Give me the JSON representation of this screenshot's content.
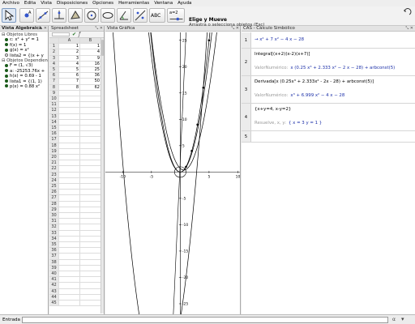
{
  "menu": [
    "Archivo",
    "Edita",
    "Vista",
    "Disposiciones",
    "Opciones",
    "Herramientas",
    "Ventana",
    "Ayuda"
  ],
  "toolbar": {
    "tools": [
      "move-tool",
      "point-tool",
      "line-tool",
      "perpendicular-tool",
      "polygon-tool",
      "circle-tool",
      "conic-tool",
      "angle-tool",
      "reflect-tool",
      "text-tool",
      "slider-tool",
      "move-view-tool"
    ],
    "text_tool_label": "ABC",
    "slider_tool_label": "a=2",
    "active_title": "Elige y Mueve",
    "active_desc": "Arrastra o selecciona objetos (Esc)"
  },
  "algebra": {
    "title": "Vista Algebraica",
    "controls": "⤡ ✕",
    "free_header": "⊟ Objetos Libres",
    "free": [
      {
        "text": "c: x² + y² = 1",
        "hollow": false
      },
      {
        "text": "f(x) = 1",
        "hollow": false
      },
      {
        "text": "g(x) = x²",
        "hollow": false
      },
      {
        "text": "lista2 = {(x + y",
        "hollow": true
      }
    ],
    "dependent_header": "⊟ Objetos Dependientes",
    "dependent": [
      {
        "text": "F = (1, √3)",
        "hollow": false
      },
      {
        "text": "a: -25253.76x +",
        "hollow": false
      },
      {
        "text": "h(x) = 0.69 - 1",
        "hollow": false
      },
      {
        "text": "lista1 = {(1, 1)",
        "hollow": false
      },
      {
        "text": "p(x) = 0.88 x²",
        "hollow": false
      }
    ]
  },
  "spreadsheet": {
    "title": "Spreadsheet",
    "controls": "⤡ ✕",
    "columns": [
      "A",
      "B"
    ],
    "rows": [
      {
        "n": "1",
        "a": "1",
        "b": "1"
      },
      {
        "n": "2",
        "a": "2",
        "b": "4"
      },
      {
        "n": "3",
        "a": "3",
        "b": "9"
      },
      {
        "n": "4",
        "a": "4",
        "b": "16"
      },
      {
        "n": "5",
        "a": "5",
        "b": "25"
      },
      {
        "n": "6",
        "a": "6",
        "b": "36"
      },
      {
        "n": "7",
        "a": "7",
        "b": "50"
      },
      {
        "n": "8",
        "a": "8",
        "b": "62"
      },
      {
        "n": "9",
        "a": "",
        "b": ""
      },
      {
        "n": "10",
        "a": "",
        "b": ""
      },
      {
        "n": "11",
        "a": "",
        "b": ""
      },
      {
        "n": "12",
        "a": "",
        "b": ""
      },
      {
        "n": "13",
        "a": "",
        "b": ""
      },
      {
        "n": "14",
        "a": "",
        "b": ""
      },
      {
        "n": "15",
        "a": "",
        "b": ""
      },
      {
        "n": "16",
        "a": "",
        "b": ""
      },
      {
        "n": "17",
        "a": "",
        "b": ""
      },
      {
        "n": "18",
        "a": "",
        "b": ""
      },
      {
        "n": "19",
        "a": "",
        "b": ""
      },
      {
        "n": "20",
        "a": "",
        "b": ""
      },
      {
        "n": "21",
        "a": "",
        "b": ""
      },
      {
        "n": "22",
        "a": "",
        "b": ""
      },
      {
        "n": "23",
        "a": "",
        "b": ""
      },
      {
        "n": "24",
        "a": "",
        "b": ""
      },
      {
        "n": "25",
        "a": "",
        "b": ""
      },
      {
        "n": "26",
        "a": "",
        "b": ""
      },
      {
        "n": "27",
        "a": "",
        "b": ""
      },
      {
        "n": "28",
        "a": "",
        "b": ""
      },
      {
        "n": "29",
        "a": "",
        "b": ""
      },
      {
        "n": "30",
        "a": "",
        "b": ""
      },
      {
        "n": "31",
        "a": "",
        "b": ""
      },
      {
        "n": "32",
        "a": "",
        "b": ""
      },
      {
        "n": "33",
        "a": "",
        "b": ""
      },
      {
        "n": "34",
        "a": "",
        "b": ""
      },
      {
        "n": "35",
        "a": "",
        "b": ""
      },
      {
        "n": "36",
        "a": "",
        "b": ""
      },
      {
        "n": "37",
        "a": "",
        "b": ""
      },
      {
        "n": "38",
        "a": "",
        "b": ""
      },
      {
        "n": "39",
        "a": "",
        "b": ""
      },
      {
        "n": "40",
        "a": "",
        "b": ""
      },
      {
        "n": "41",
        "a": "",
        "b": ""
      },
      {
        "n": "42",
        "a": "",
        "b": ""
      },
      {
        "n": "43",
        "a": "",
        "b": ""
      },
      {
        "n": "44",
        "a": "",
        "b": ""
      },
      {
        "n": "45",
        "a": "",
        "b": ""
      }
    ]
  },
  "graphics": {
    "title": "Vista Gráfica",
    "controls": "⤡ ✕",
    "x_range": [
      -13,
      10.5
    ],
    "y_range": [
      -27,
      26.5
    ],
    "x_ticks": [
      -10,
      -5,
      5,
      10
    ],
    "y_ticks": [
      -25,
      -20,
      -15,
      -10,
      -5,
      5,
      10,
      15,
      20,
      25
    ],
    "points": [
      [
        1,
        1
      ],
      [
        2,
        4
      ],
      [
        3,
        9
      ],
      [
        4,
        16
      ],
      [
        5,
        25
      ],
      [
        6,
        36
      ]
    ],
    "functions": [
      "x^2",
      "0.88x^2",
      "x^2+7x-28"
    ]
  },
  "cas": {
    "title": "CAS - Cálculo Simbólico",
    "controls": "⤡ ✕",
    "rows": [
      {
        "n": "1",
        "input": "",
        "output": "→  x² + 7 x² − 4 x − 28",
        "label": ""
      },
      {
        "n": "2",
        "input": "Integral[(x+2)(x-2)(x+7)]",
        "output": "x (0.25 x³ + 2.333 x² − 2 x − 28) + arbconst(5)",
        "label": "ValorNumérico:"
      },
      {
        "n": "3",
        "input": "Derivada[x (0.25x³ + 2.333x² - 2x - 28) + arbconst(5)]",
        "output": "x³ + 6.999 x² − 4 x − 28",
        "label": "ValorNumérico:"
      },
      {
        "n": "4",
        "input": "{x+y=4, x-y=2}",
        "output": "{ x = 3   y = 1 }",
        "label": "Resuelve, x, y:"
      },
      {
        "n": "5",
        "input": "",
        "output": "",
        "label": ""
      }
    ]
  },
  "input": {
    "label": "Entrada",
    "value": ""
  },
  "colors": {
    "algebra_dot": "#1a5b1a",
    "cas_output": "#1b2fa8"
  }
}
